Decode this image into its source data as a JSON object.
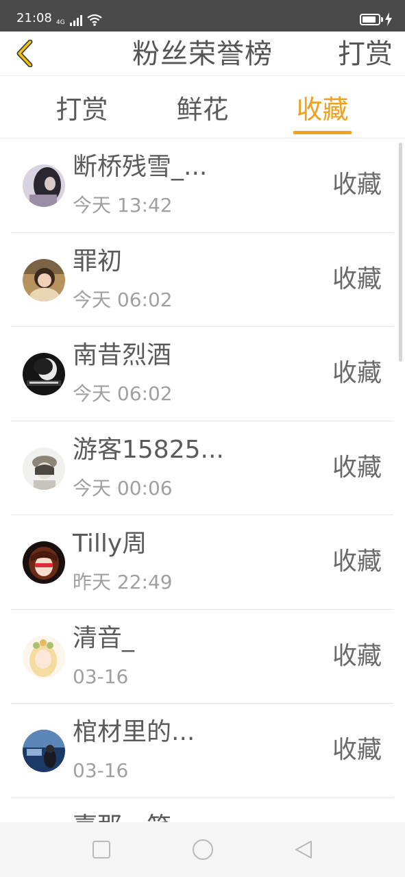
{
  "status_bar": {
    "time": "21:08",
    "network_label": "4G",
    "battery_level": 0.85
  },
  "header": {
    "back_icon": "chevron-left-icon",
    "title": "粉丝荣誉榜",
    "action_label": "打赏"
  },
  "tabs": [
    {
      "label": "打赏",
      "active": false
    },
    {
      "label": "鲜花",
      "active": false
    },
    {
      "label": "收藏",
      "active": true
    }
  ],
  "colors": {
    "accent": "#f1a11e",
    "status_bar_bg": "#4a4a4a",
    "text_primary": "#5a5a5a",
    "text_secondary": "#a0a0a0"
  },
  "fans": [
    {
      "name": "断桥残雪_...",
      "time": "今天 13:42",
      "action": "收藏"
    },
    {
      "name": "罪初",
      "time": "今天 06:02",
      "action": "收藏"
    },
    {
      "name": "南昔烈酒",
      "time": "今天 06:02",
      "action": "收藏"
    },
    {
      "name": "游客15825...",
      "time": "今天 00:06",
      "action": "收藏"
    },
    {
      "name": "Tilly周",
      "time": "昨天 22:49",
      "action": "收藏"
    },
    {
      "name": "清音_",
      "time": "03-16",
      "action": "收藏"
    },
    {
      "name": "棺材里的...",
      "time": "03-16",
      "action": "收藏"
    },
    {
      "name": "嘉那一笑",
      "time": "",
      "action": ""
    }
  ],
  "nav_bar": {
    "recent_icon": "square-icon",
    "home_icon": "circle-icon",
    "back_icon": "triangle-back-icon"
  }
}
